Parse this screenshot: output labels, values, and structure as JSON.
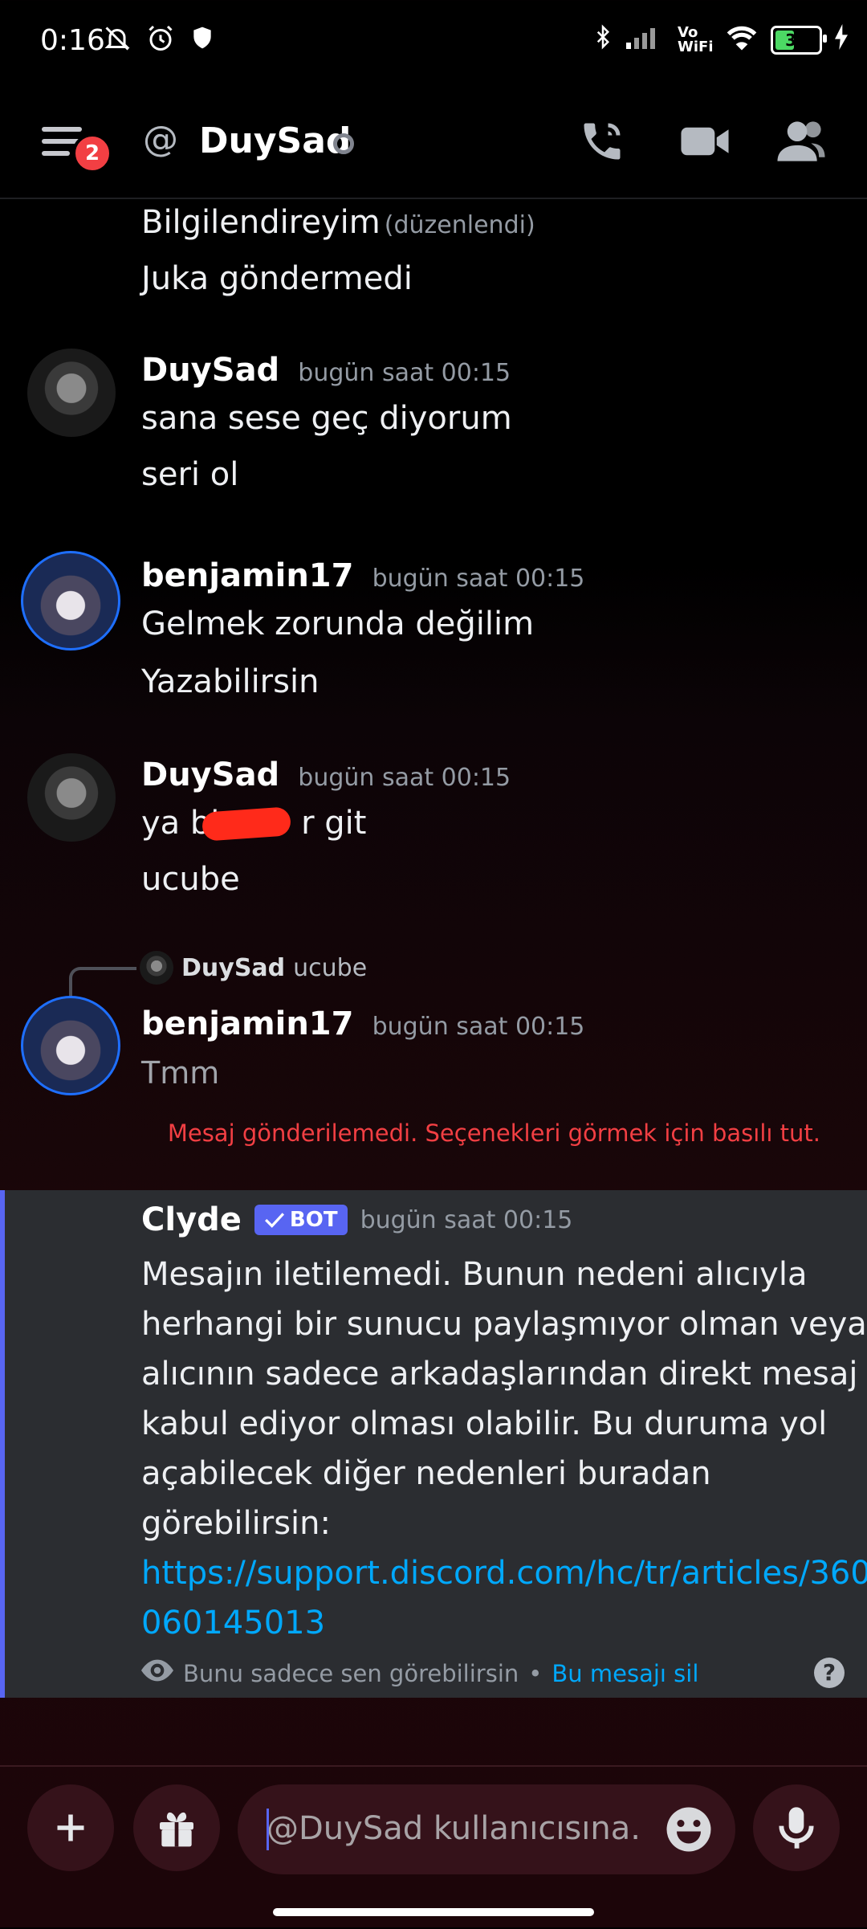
{
  "status_bar": {
    "time": "0:16",
    "battery": "39",
    "vowifi": "Vo WiFi"
  },
  "header": {
    "notification_count": "2",
    "title": "DuySad"
  },
  "messages": [
    {
      "text_1": "Bilgilendireyim",
      "edited": "(düzenlendi)",
      "text_2": "Juka göndermedi"
    },
    {
      "author": "DuySad",
      "timestamp": "bugün saat 00:15",
      "lines": [
        "sana sese geç diyorum",
        "seri ol"
      ]
    },
    {
      "author": "benjamin17",
      "timestamp": "bugün saat 00:15",
      "lines": [
        "Gelmek zorunda değilim",
        "Yazabilirsin"
      ]
    },
    {
      "author": "DuySad",
      "timestamp": "bugün saat 00:15",
      "lines": [
        "ya bi        r git",
        "ucube"
      ]
    },
    {
      "reply_author": "DuySad",
      "reply_text": "ucube",
      "author": "benjamin17",
      "timestamp": "bugün saat 00:15",
      "lines": [
        "Tmm"
      ],
      "error": "Mesaj gönderilemedi. Seçenekleri görmek için basılı tut."
    }
  ],
  "bot_message": {
    "author": "Clyde",
    "badge": "BOT",
    "timestamp": "bugün saat 00:15",
    "text": "Mesajın iletilemedi. Bunun nedeni alıcıyla herhangi bir sunucu paylaşmıyor olman veya alıcının sadece arkadaşlarından direkt mesaj kabul ediyor olması olabilir. Bu duruma yol açabilecek diğer nedenleri buradan görebilirsin:",
    "link": "https://support.discord.com/hc/tr/articles/360060145013",
    "visibility_note": "Bunu sadece sen görebilirsin",
    "separator": "•",
    "delete_label": "Bu mesajı sil"
  },
  "composer": {
    "placeholder": "@DuySad kullanıcısına..."
  },
  "colors": {
    "blurple": "#5865f2",
    "error_red": "#f23f43",
    "link_blue": "#00a8fc"
  }
}
